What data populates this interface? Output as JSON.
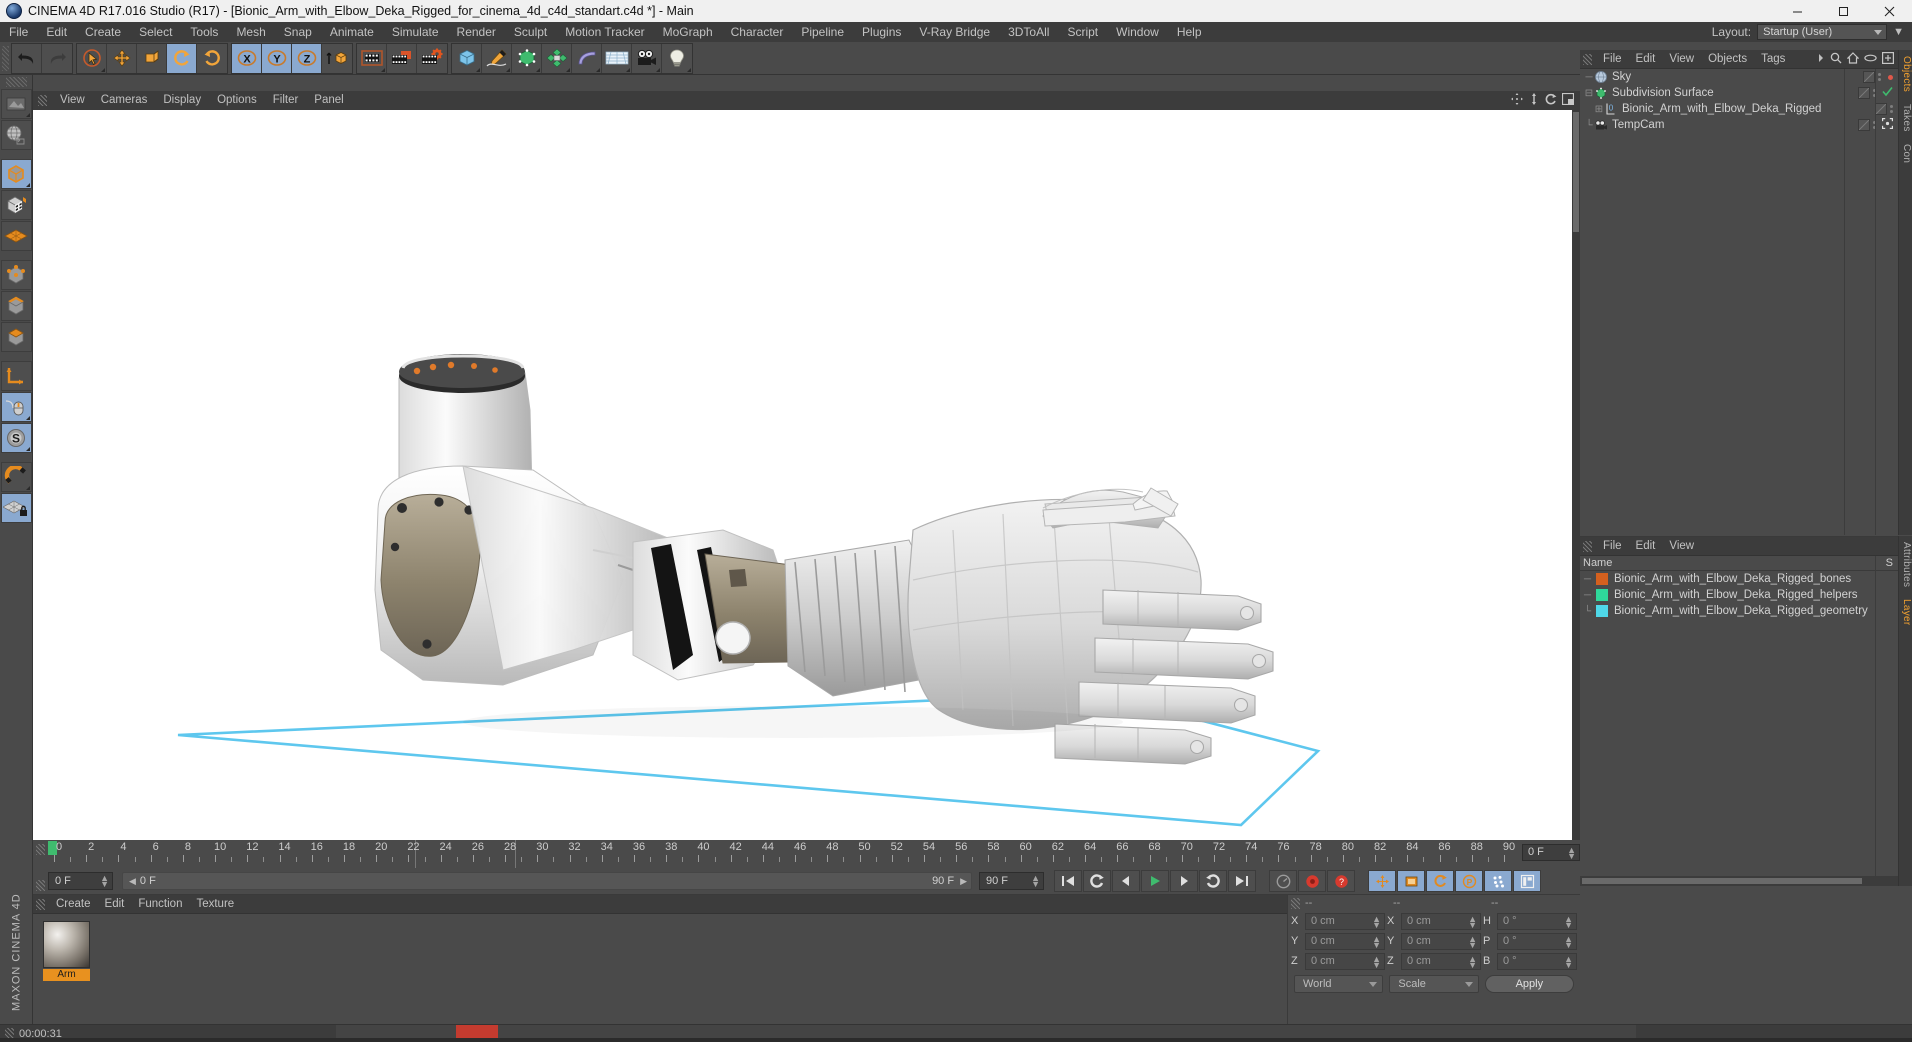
{
  "window": {
    "title": "CINEMA 4D R17.016 Studio (R17) - [Bionic_Arm_with_Elbow_Deka_Rigged_for_cinema_4d_c4d_standart.c4d *] - Main",
    "app_icon": "c4d-sphere-icon",
    "minimize": "minimize-icon",
    "maximize": "maximize-icon",
    "close": "close-icon"
  },
  "menubar": {
    "items": [
      "File",
      "Edit",
      "Create",
      "Select",
      "Tools",
      "Mesh",
      "Snap",
      "Animate",
      "Simulate",
      "Render",
      "Sculpt",
      "Motion Tracker",
      "MoGraph",
      "Character",
      "Pipeline",
      "Plugins",
      "V-Ray Bridge",
      "3DToAll",
      "Script",
      "Window",
      "Help"
    ],
    "layout_label": "Layout:",
    "layout_value": "Startup (User)"
  },
  "toolbar": {
    "groups": [
      {
        "name": "undo-redo",
        "buttons": [
          {
            "name": "undo-button",
            "icon": "undo-arrow-icon",
            "state": "normal"
          },
          {
            "name": "redo-button",
            "icon": "redo-arrow-icon",
            "state": "disabled"
          }
        ]
      },
      {
        "name": "transform-tools",
        "buttons": [
          {
            "name": "live-selection-tool",
            "icon": "cursor-circle-icon",
            "state": "normal"
          },
          {
            "name": "move-tool",
            "icon": "move-arrows-icon",
            "state": "normal"
          },
          {
            "name": "scale-tool",
            "icon": "scale-box-icon",
            "state": "normal"
          },
          {
            "name": "rotate-tool",
            "icon": "rotate-arrows-icon",
            "state": "active"
          },
          {
            "name": "global-local-toggle",
            "icon": "rotate-single-icon",
            "state": "normal"
          }
        ]
      },
      {
        "name": "axis-locks",
        "buttons": [
          {
            "name": "lock-x-axis",
            "icon": "x-axis-icon",
            "state": "active"
          },
          {
            "name": "lock-y-axis",
            "icon": "y-axis-icon",
            "state": "active"
          },
          {
            "name": "lock-z-axis",
            "icon": "z-axis-icon",
            "state": "active"
          },
          {
            "name": "world-object-coordinates",
            "icon": "world-cube-icon",
            "state": "normal"
          }
        ]
      },
      {
        "name": "render-tools",
        "buttons": [
          {
            "name": "render-view-button",
            "icon": "clapperboard-icon",
            "state": "normal"
          },
          {
            "name": "render-to-picture-viewer-button",
            "icon": "clapperboard-picture-icon",
            "state": "normal"
          },
          {
            "name": "render-settings-button",
            "icon": "clapperboard-gear-icon",
            "state": "normal"
          }
        ]
      },
      {
        "name": "create-objects",
        "buttons": [
          {
            "name": "add-cube-object",
            "icon": "blue-cube-icon",
            "state": "normal"
          },
          {
            "name": "add-spline-object",
            "icon": "pen-spline-icon",
            "state": "normal"
          },
          {
            "name": "add-generator-object",
            "icon": "green-subdivision-icon",
            "state": "normal"
          },
          {
            "name": "add-mograph-object",
            "icon": "green-cluster-icon",
            "state": "normal"
          },
          {
            "name": "add-deformer-object",
            "icon": "purple-bend-icon",
            "state": "normal"
          },
          {
            "name": "add-environment-object",
            "icon": "floor-grid-icon",
            "state": "normal"
          },
          {
            "name": "add-camera-object",
            "icon": "camera-icon",
            "state": "normal"
          },
          {
            "name": "add-light-object",
            "icon": "light-bulb-icon",
            "state": "normal"
          }
        ]
      }
    ]
  },
  "left_toolbar": {
    "buttons": [
      {
        "name": "render-region-tool",
        "icon": "render-region-icon",
        "state": "normal"
      },
      {
        "name": "make-editable-tool",
        "icon": "globe-editable-icon",
        "state": "normal"
      },
      {
        "name": "model-mode",
        "icon": "model-cube-icon",
        "state": "active"
      },
      {
        "name": "texture-mode",
        "icon": "texture-checker-cube-icon",
        "state": "normal"
      },
      {
        "name": "workplane-mode",
        "icon": "workplane-grid-icon",
        "state": "normal"
      },
      {
        "name": "point-mode",
        "icon": "point-cube-icon",
        "state": "normal"
      },
      {
        "name": "edge-mode",
        "icon": "edge-cube-icon",
        "state": "normal"
      },
      {
        "name": "polygon-mode",
        "icon": "polygon-cube-icon",
        "state": "normal"
      },
      {
        "name": "axis-modification-tool",
        "icon": "axis-L-icon",
        "state": "normal"
      },
      {
        "name": "enable-snapping-tool",
        "icon": "mouse-snap-icon",
        "state": "active"
      },
      {
        "name": "soft-selection-tool",
        "icon": "s-circle-icon",
        "state": "active"
      },
      {
        "name": "magnet-tool",
        "icon": "magnet-icon",
        "state": "normal"
      },
      {
        "name": "lock-workplane-tool",
        "icon": "workplane-lock-icon",
        "state": "active"
      }
    ],
    "brand": "MAXON CINEMA 4D"
  },
  "viewport": {
    "menu": [
      "View",
      "Cameras",
      "Display",
      "Options",
      "Filter",
      "Panel"
    ],
    "corner_icons": [
      "pan-icon",
      "dolly-icon",
      "rotate-icon",
      "maximize-viewport-icon"
    ],
    "background": "#ffffff",
    "scene": {
      "model": "Bionic arm with hand, white/grey prosthetic",
      "floor_grid_color": "#5ec7ee"
    }
  },
  "object_manager": {
    "menu": [
      "File",
      "Edit",
      "View",
      "Objects",
      "Tags"
    ],
    "overflow": "chevron-right-icon",
    "icons": [
      "search-icon",
      "home-icon",
      "ellipse-icon",
      "new-tag-icon"
    ],
    "objects": [
      {
        "name": "Sky",
        "icon": "sky-sphere-icon",
        "indent": 0,
        "expander": "",
        "tag": "",
        "marker": "red-dot"
      },
      {
        "name": "Subdivision Surface",
        "icon": "subdivision-green-icon",
        "indent": 0,
        "expander": "minus",
        "tag": "",
        "marker": "green-check"
      },
      {
        "name": "Bionic_Arm_with_Elbow_Deka_Rigged",
        "icon": "null-object-icon",
        "indent": 1,
        "expander": "plus",
        "tag": "",
        "marker": ""
      },
      {
        "name": "TempCam",
        "icon": "camera-object-icon",
        "indent": 0,
        "expander": "",
        "tag": "",
        "marker": "target-icon"
      }
    ],
    "side_tabs": [
      "Objects",
      "Takes",
      "Con"
    ]
  },
  "layer_manager": {
    "menu": [
      "File",
      "Edit",
      "View"
    ],
    "columns": [
      "Name",
      "S"
    ],
    "layers": [
      {
        "name": "Bionic_Arm_with_Elbow_Deka_Rigged_bones",
        "color": "#d4601e"
      },
      {
        "name": "Bionic_Arm_with_Elbow_Deka_Rigged_helpers",
        "color": "#2fd89a"
      },
      {
        "name": "Bionic_Arm_with_Elbow_Deka_Rigged_geometry",
        "color": "#4fd8e8"
      }
    ],
    "side_tabs": [
      "Attributes",
      "Layer"
    ]
  },
  "timeline": {
    "ticks": [
      0,
      2,
      4,
      6,
      8,
      10,
      12,
      14,
      16,
      18,
      20,
      22,
      24,
      26,
      28,
      30,
      32,
      34,
      36,
      38,
      40,
      42,
      44,
      46,
      48,
      50,
      52,
      54,
      56,
      58,
      60,
      62,
      64,
      66,
      68,
      70,
      72,
      74,
      76,
      78,
      80,
      82,
      84,
      86,
      88,
      90
    ],
    "min": 0,
    "max": 90,
    "current_frame": 0,
    "frame_field": "0 F"
  },
  "playback": {
    "current_frame_field": "0 F",
    "preview_field": "0 F",
    "range_end_field": "90 F",
    "max_field": "90 F",
    "buttons": [
      {
        "name": "go-to-start-button",
        "icon": "skip-start-icon"
      },
      {
        "name": "play-backwards-loop-button",
        "icon": "loop-back-icon"
      },
      {
        "name": "step-back-button",
        "icon": "prev-frame-icon"
      },
      {
        "name": "play-button",
        "icon": "play-icon"
      },
      {
        "name": "step-forward-button",
        "icon": "next-frame-icon"
      },
      {
        "name": "play-forward-loop-button",
        "icon": "loop-forward-icon"
      },
      {
        "name": "go-to-end-button",
        "icon": "skip-end-icon"
      },
      {
        "name": "record-active-objects-button",
        "icon": "gauge-icon"
      },
      {
        "name": "autokeying-button",
        "icon": "record-red-icon"
      },
      {
        "name": "keyframe-selection-button",
        "icon": "record-question-icon"
      },
      {
        "name": "position-key-button",
        "icon": "position-key-icon"
      },
      {
        "name": "scale-key-button",
        "icon": "scale-key-icon"
      },
      {
        "name": "rotation-key-button",
        "icon": "rotation-key-icon"
      },
      {
        "name": "param-key-button",
        "icon": "param-key-icon"
      },
      {
        "name": "point-level-animation-button",
        "icon": "pla-dots-icon"
      },
      {
        "name": "animation-layout-button",
        "icon": "animation-layout-icon"
      }
    ]
  },
  "material_manager": {
    "menu": [
      "Create",
      "Edit",
      "Function",
      "Texture"
    ],
    "materials": [
      {
        "name": "Arm",
        "preview": "grey-sphere-preview"
      }
    ]
  },
  "coordinates": {
    "headers": [
      "--",
      "--",
      "--"
    ],
    "rows": [
      {
        "left_label": "X",
        "left_value": "0 cm",
        "mid_label": "X",
        "mid_value": "0 cm",
        "right_label": "H",
        "right_value": "0 °"
      },
      {
        "left_label": "Y",
        "left_value": "0 cm",
        "mid_label": "Y",
        "mid_value": "0 cm",
        "right_label": "P",
        "right_value": "0 °"
      },
      {
        "left_label": "Z",
        "left_value": "0 cm",
        "mid_label": "Z",
        "mid_value": "0 cm",
        "right_label": "B",
        "right_value": "0 °"
      }
    ],
    "coord_system": "World",
    "size_mode": "Scale",
    "apply_label": "Apply"
  },
  "statusbar": {
    "time": "00:00:31"
  },
  "colors": {
    "accent_orange": "#e8911f",
    "panel_bg": "#4a4a4a",
    "dark_bg": "#3c3c3c",
    "selection_blue": "#8aa9d0",
    "grid_blue": "#5ec7ee"
  }
}
